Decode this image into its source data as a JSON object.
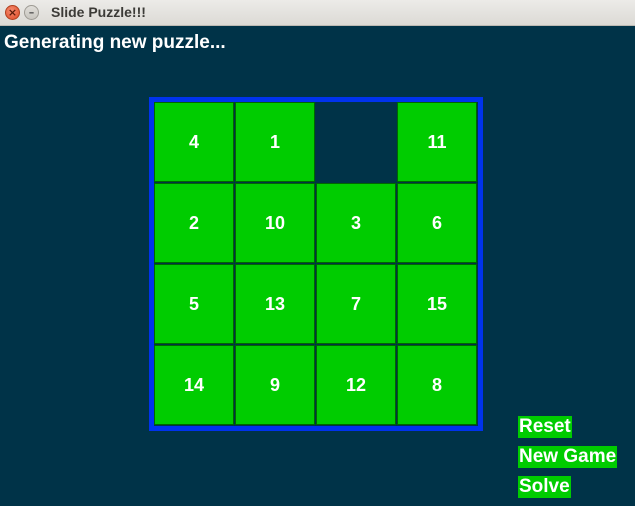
{
  "window": {
    "title": "Slide Puzzle!!!"
  },
  "status_text": "Generating new puzzle...",
  "colors": {
    "background": "#003348",
    "tile": "#00cc00",
    "tile_border": "#006600",
    "board_border": "#0033ee",
    "text": "#ffffff"
  },
  "board": {
    "rows": [
      [
        "4",
        "1",
        "",
        "11"
      ],
      [
        "2",
        "10",
        "3",
        "6"
      ],
      [
        "5",
        "13",
        "7",
        "15"
      ],
      [
        "14",
        "9",
        "12",
        "8"
      ]
    ]
  },
  "buttons": {
    "reset": "Reset",
    "new_game": "New Game",
    "solve": "Solve"
  }
}
